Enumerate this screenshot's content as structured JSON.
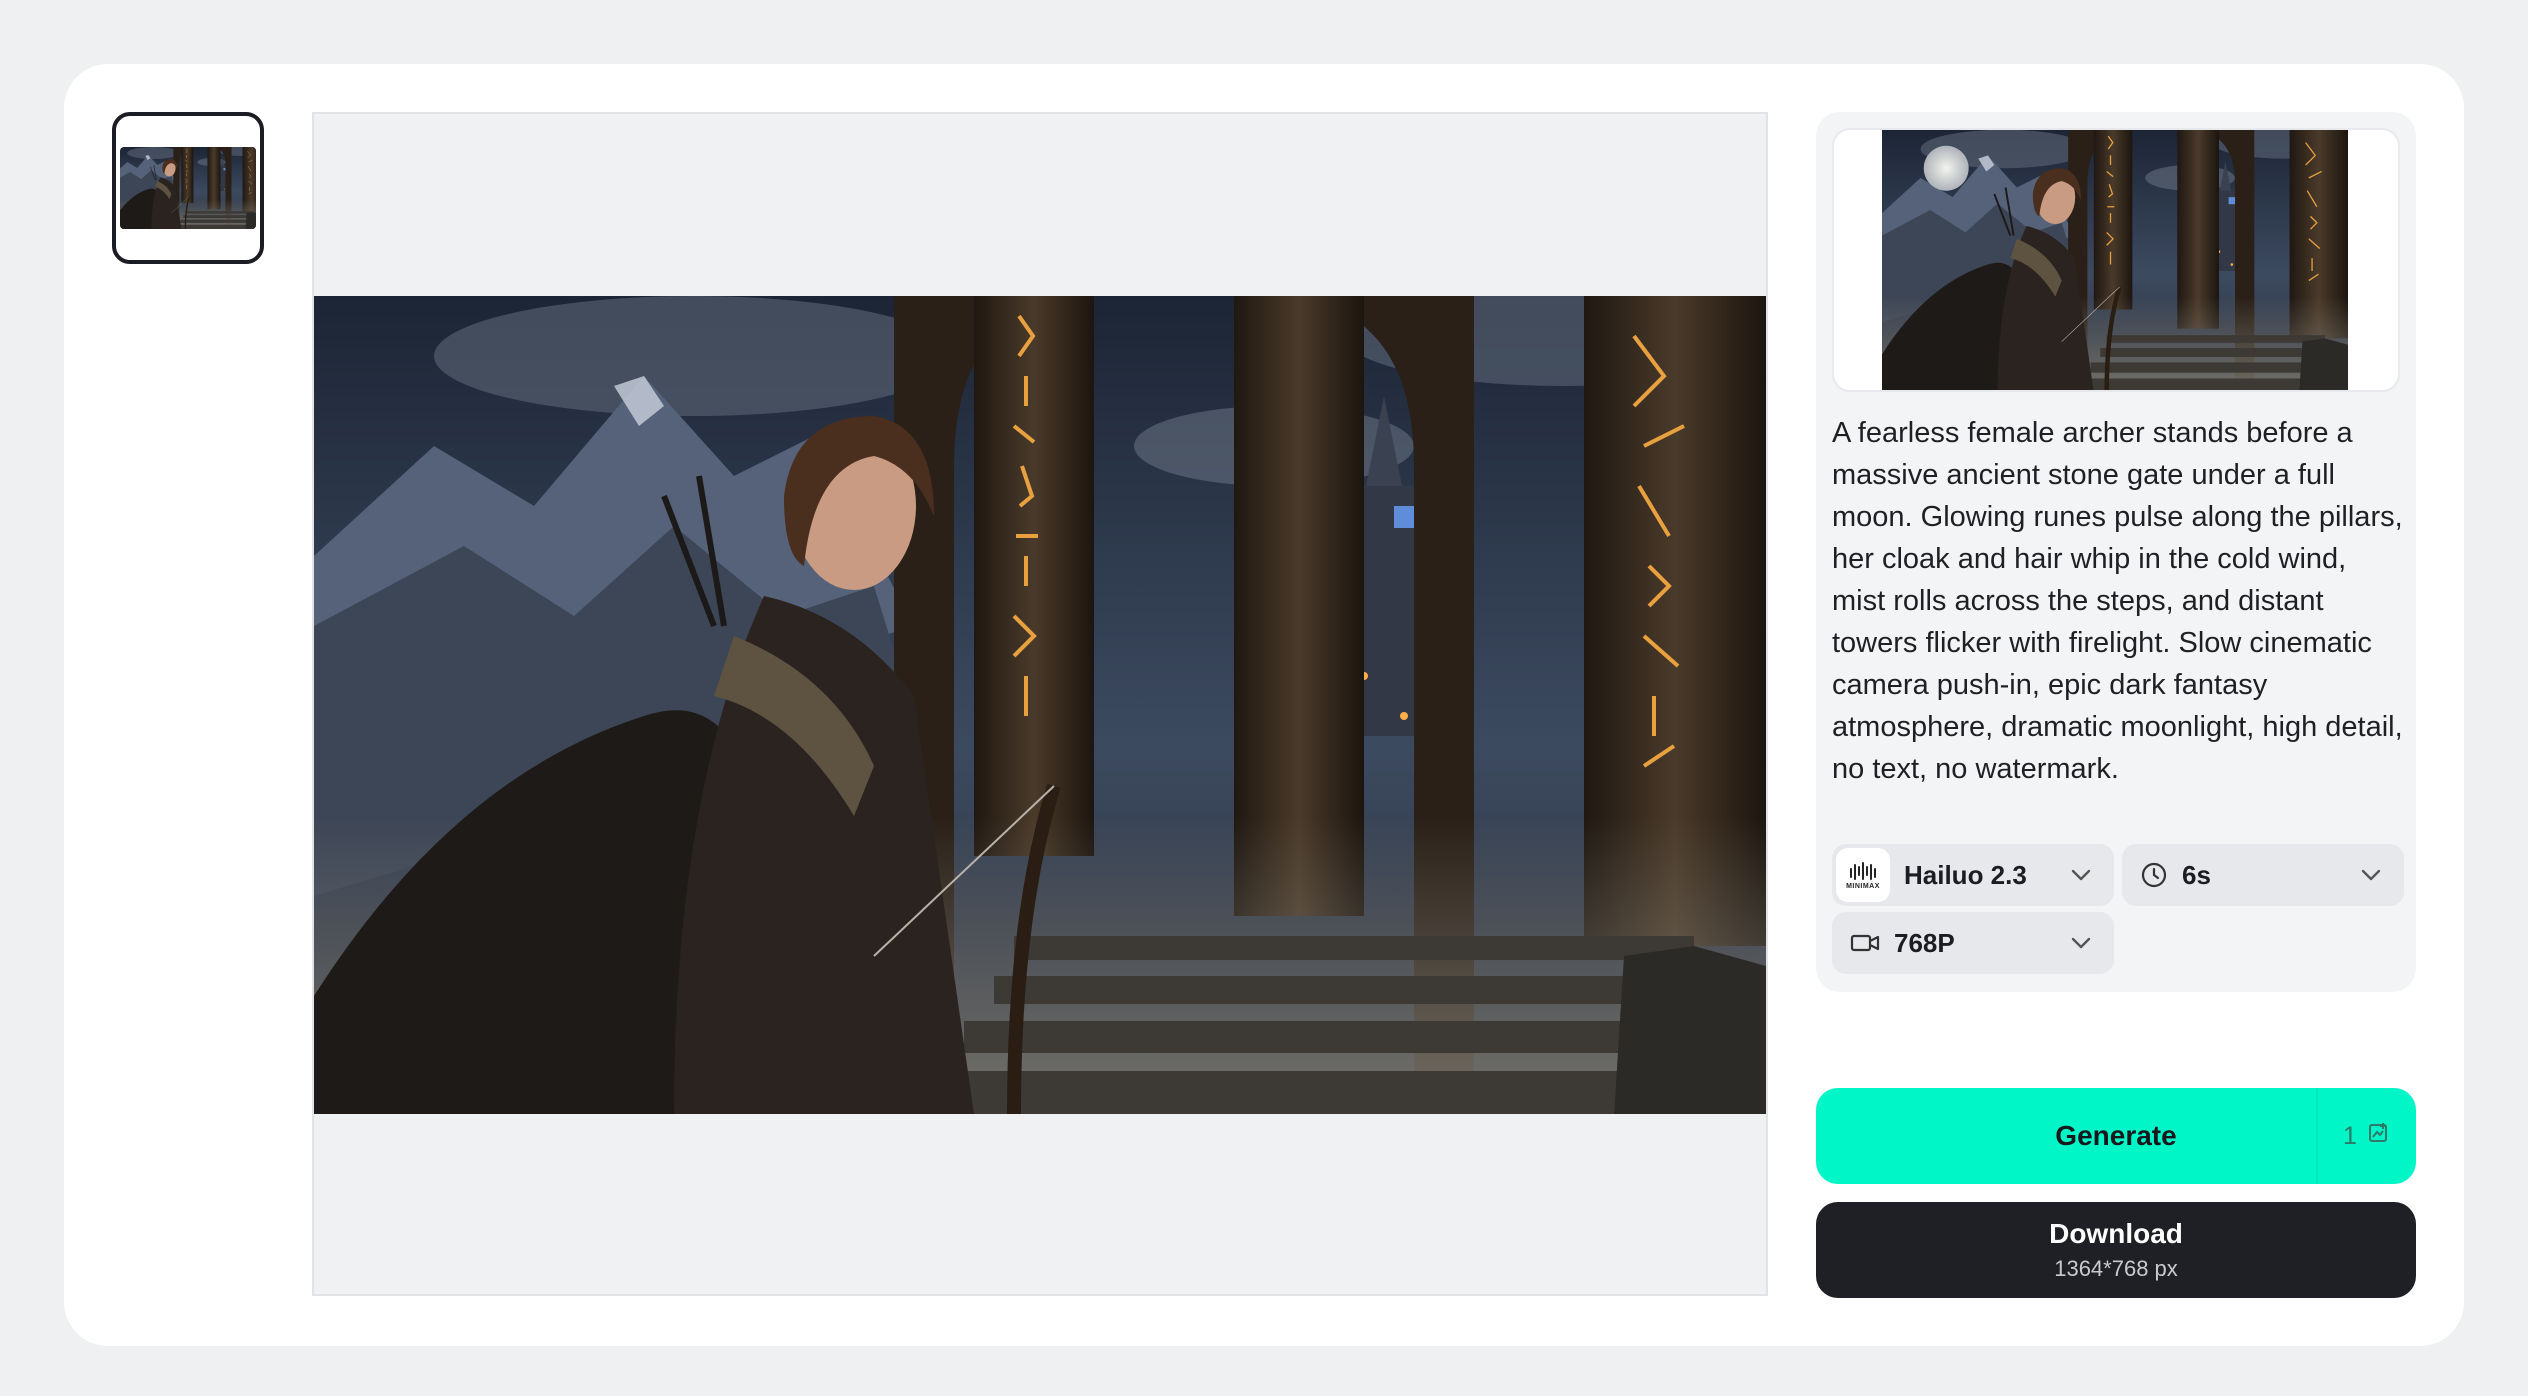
{
  "prompt": "A fearless female archer stands before a massive ancient stone gate under a full moon. Glowing runes pulse along the pillars, her cloak and hair whip in the cold wind, mist rolls across the steps, and distant towers flicker with firelight. Slow cinematic camera push-in, epic dark fantasy atmosphere, dramatic moonlight, high detail, no text, no watermark.",
  "settings": {
    "model": {
      "label": "Hailuo 2.3",
      "logo_text": "MINIMAX",
      "icon": "minimax-logo-icon"
    },
    "duration": {
      "label": "6s",
      "icon": "clock-icon"
    },
    "resolution": {
      "label": "768P",
      "icon": "video-camera-icon"
    }
  },
  "actions": {
    "generate_label": "Generate",
    "generate_cost": "1",
    "generate_cost_icon": "credit-icon",
    "download_label": "Download",
    "download_size": "1364*768 px"
  },
  "colors": {
    "accent": "#00f5c7",
    "dark_button": "#1f2025",
    "panel_bg": "#f3f4f6"
  }
}
